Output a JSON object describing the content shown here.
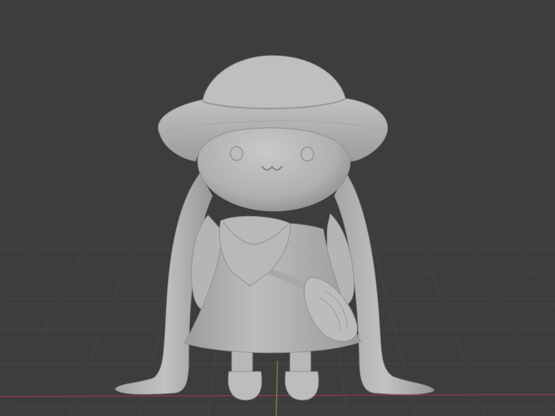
{
  "viewport": {
    "background_color": "#3d3d3d",
    "grid_color": "#474747",
    "x_axis_color": "#8a3a44",
    "y_axis_color": "#6e8a3a",
    "model_color": "#b4b4b4",
    "model_shadow_color": "#8f8f8f"
  },
  "model": {
    "parts": [
      "hat",
      "head",
      "hair",
      "arms",
      "collar",
      "dress",
      "bag",
      "legs"
    ],
    "face": [
      "left-eye",
      "right-eye",
      "mouth"
    ]
  }
}
